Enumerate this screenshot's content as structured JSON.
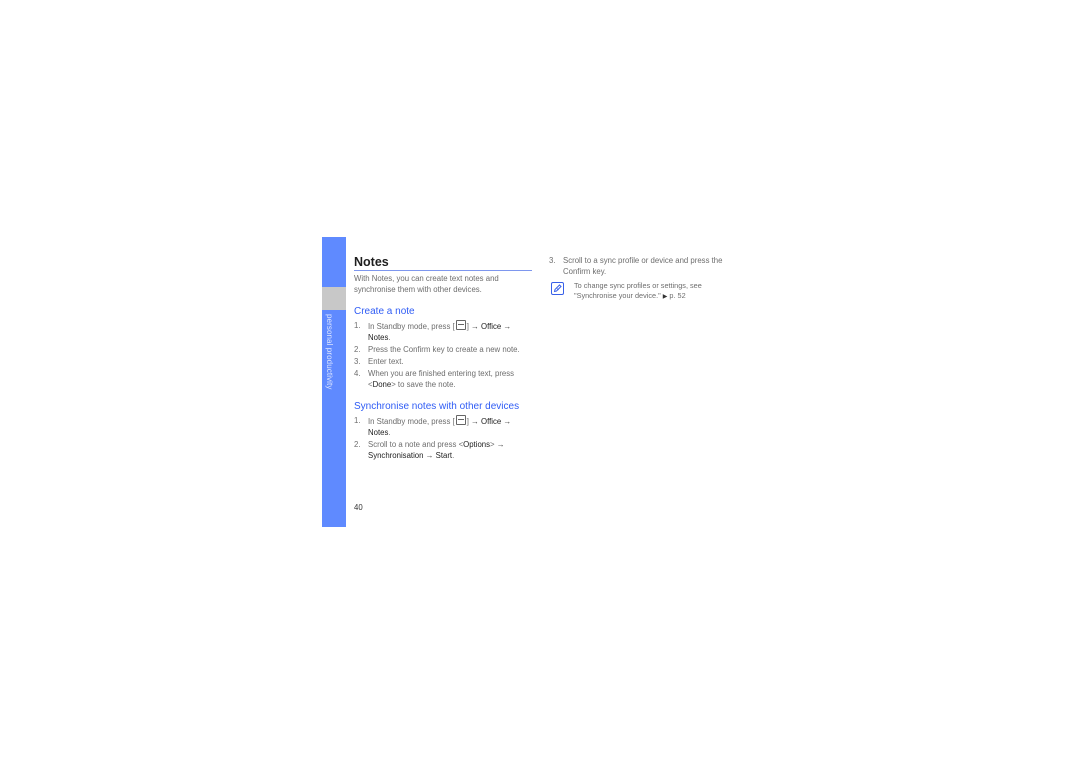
{
  "sidebar": {
    "section_label": "personal productivity",
    "colors": {
      "tab": "#5f8aff",
      "marker": "#c8c8c8"
    }
  },
  "page": {
    "title": "Notes",
    "intro": "With Notes, you can create text notes and synchronise them with other devices.",
    "page_number": "40",
    "accent_color": "#2f5cf5"
  },
  "create_note": {
    "heading": "Create a note",
    "steps": [
      {
        "num": "1.",
        "pre": "In Standby mode, press [",
        "post": "] ",
        "arrow1": "→",
        "k1": "Office",
        "arrow2": "→",
        "k2": "Notes",
        "end": "."
      },
      {
        "num": "2.",
        "text": "Press the Confirm key to create a new note."
      },
      {
        "num": "3.",
        "text": "Enter text."
      },
      {
        "num": "4.",
        "pre": "When you are finished entering text, press <",
        "k1": "Done",
        "post": "> to save the note."
      }
    ]
  },
  "sync": {
    "heading": "Synchronise notes with other devices",
    "steps": [
      {
        "num": "1.",
        "pre": "In Standby mode, press [",
        "post": "] ",
        "arrow1": "→",
        "k1": "Office",
        "arrow2": "→",
        "k2": "Notes",
        "end": "."
      },
      {
        "num": "2.",
        "pre": "Scroll to a note and press <",
        "k1": "Options",
        "mid": "> ",
        "arrow1": "→",
        "k2": "Synchronisation",
        "arrow2": "→",
        "k3": "Start",
        "end": "."
      },
      {
        "num": "3.",
        "text": "Scroll to a sync profile or device and press the Confirm key."
      }
    ],
    "note": {
      "icon": "pencil-note-icon",
      "text": "To change sync profiles or settings, see \"Synchronise your device.\"",
      "ref_arrow": "▶",
      "ref": "p. 52"
    }
  }
}
